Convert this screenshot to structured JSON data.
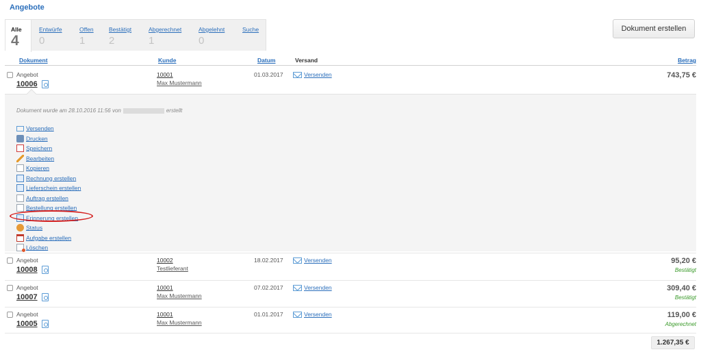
{
  "page": {
    "title": "Angebote"
  },
  "toolbar": {
    "create_label": "Dokument erstellen"
  },
  "tabs": [
    {
      "label": "Alle",
      "count": "4"
    },
    {
      "label": "Entwürfe",
      "count": "0"
    },
    {
      "label": "Offen",
      "count": "1"
    },
    {
      "label": "Bestätigt",
      "count": "2"
    },
    {
      "label": "Abgerechnet",
      "count": "1"
    },
    {
      "label": "Abgelehnt",
      "count": "0"
    },
    {
      "label": "Suche",
      "count": ""
    }
  ],
  "columns": {
    "document": "Dokument",
    "customer": "Kunde",
    "date": "Datum",
    "shipping": "Versand",
    "amount": "Betrag"
  },
  "rows": [
    {
      "type": "Angebot",
      "number": "10006",
      "customer_no": "10001",
      "customer_name": "Max Mustermann",
      "date": "01.03.2017",
      "send": "Versenden",
      "amount": "743,75 €",
      "status": ""
    },
    {
      "type": "Angebot",
      "number": "10008",
      "customer_no": "10002",
      "customer_name": "Testlieferant",
      "date": "18.02.2017",
      "send": "Versenden",
      "amount": "95,20 €",
      "status": "Bestätigt"
    },
    {
      "type": "Angebot",
      "number": "10007",
      "customer_no": "10001",
      "customer_name": "Max Mustermann",
      "date": "07.02.2017",
      "send": "Versenden",
      "amount": "309,40 €",
      "status": "Bestätigt"
    },
    {
      "type": "Angebot",
      "number": "10005",
      "customer_no": "10001",
      "customer_name": "Max Mustermann",
      "date": "01.01.2017",
      "send": "Versenden",
      "amount": "119,00 €",
      "status": "Abgerechnet"
    }
  ],
  "detail": {
    "note_prefix": "Dokument wurde am 28.10.2016 11:56 von",
    "note_suffix": "erstellt",
    "actions": [
      {
        "label": "Versenden",
        "icon": "mail-icon"
      },
      {
        "label": "Drucken",
        "icon": "printer-icon"
      },
      {
        "label": "Speichern",
        "icon": "pdf-icon"
      },
      {
        "label": "Bearbeiten",
        "icon": "pencil-icon"
      },
      {
        "label": "Kopieren",
        "icon": "copy-icon"
      },
      {
        "label": "Rechnung erstellen",
        "icon": "invoice-icon"
      },
      {
        "label": "Lieferschein erstellen",
        "icon": "delivery-note-icon"
      },
      {
        "label": "Auftrag erstellen",
        "icon": "order-icon"
      },
      {
        "label": "Bestellung erstellen",
        "icon": "purchase-order-icon"
      },
      {
        "label": "Erinnerung erstellen",
        "icon": "reminder-icon"
      },
      {
        "label": "Status",
        "icon": "status-icon"
      },
      {
        "label": "Aufgabe erstellen",
        "icon": "calendar-icon"
      },
      {
        "label": "Löschen",
        "icon": "delete-icon"
      }
    ]
  },
  "summary": {
    "total": "1.267,35 €"
  }
}
